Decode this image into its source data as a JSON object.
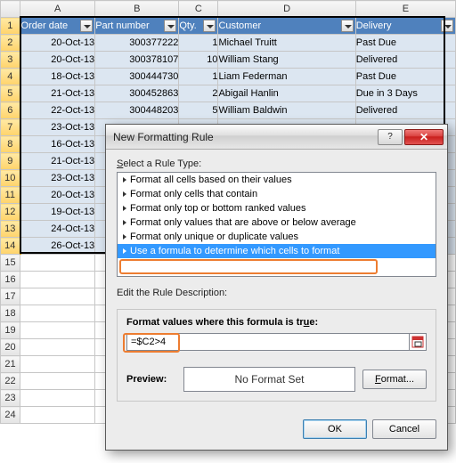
{
  "columns": [
    "A",
    "B",
    "C",
    "D",
    "E"
  ],
  "headers": {
    "A": "Order date",
    "B": "Part number",
    "C": "Qty.",
    "D": "Customer",
    "E": "Delivery"
  },
  "rows": [
    {
      "n": "1"
    },
    {
      "n": "2",
      "A": "20-Oct-13",
      "B": "300377222",
      "C": "1",
      "D": "Michael Truitt",
      "E": "Past Due"
    },
    {
      "n": "3",
      "A": "20-Oct-13",
      "B": "300378107",
      "C": "10",
      "D": "William Stang",
      "E": "Delivered"
    },
    {
      "n": "4",
      "A": "18-Oct-13",
      "B": "300444730",
      "C": "1",
      "D": "Liam Federman",
      "E": "Past Due"
    },
    {
      "n": "5",
      "A": "21-Oct-13",
      "B": "300452863",
      "C": "2",
      "D": "Abigail Hanlin",
      "E": "Due in 3 Days"
    },
    {
      "n": "6",
      "A": "22-Oct-13",
      "B": "300448203",
      "C": "5",
      "D": "William Baldwin",
      "E": "Delivered"
    },
    {
      "n": "7",
      "A": "23-Oct-13"
    },
    {
      "n": "8",
      "A": "16-Oct-13"
    },
    {
      "n": "9",
      "A": "21-Oct-13"
    },
    {
      "n": "10",
      "A": "23-Oct-13"
    },
    {
      "n": "11",
      "A": "20-Oct-13"
    },
    {
      "n": "12",
      "A": "19-Oct-13"
    },
    {
      "n": "13",
      "A": "24-Oct-13"
    },
    {
      "n": "14",
      "A": "26-Oct-13"
    }
  ],
  "empty_rows": [
    "15",
    "16",
    "17",
    "18",
    "19",
    "20",
    "21",
    "22",
    "23",
    "24"
  ],
  "dialog": {
    "title": "New Formatting Rule",
    "help_glyph": "?",
    "close_glyph": "✕",
    "select_label": "Select a Rule Type:",
    "rule_types": [
      "Format all cells based on their values",
      "Format only cells that contain",
      "Format only top or bottom ranked values",
      "Format only values that are above or below average",
      "Format only unique or duplicate values",
      "Use a formula to determine which cells to format"
    ],
    "selected_index": 5,
    "edit_label": "Edit the Rule Description:",
    "formula_label": "Format values where this formula is true:",
    "formula_value": "=$C2>4",
    "preview_label": "Preview:",
    "preview_text": "No Format Set",
    "format_btn": "Format...",
    "ok": "OK",
    "cancel": "Cancel"
  },
  "col_widths": {
    "rh": "22",
    "A": "84",
    "B": "94",
    "C": "44",
    "D": "154",
    "E": "112"
  }
}
